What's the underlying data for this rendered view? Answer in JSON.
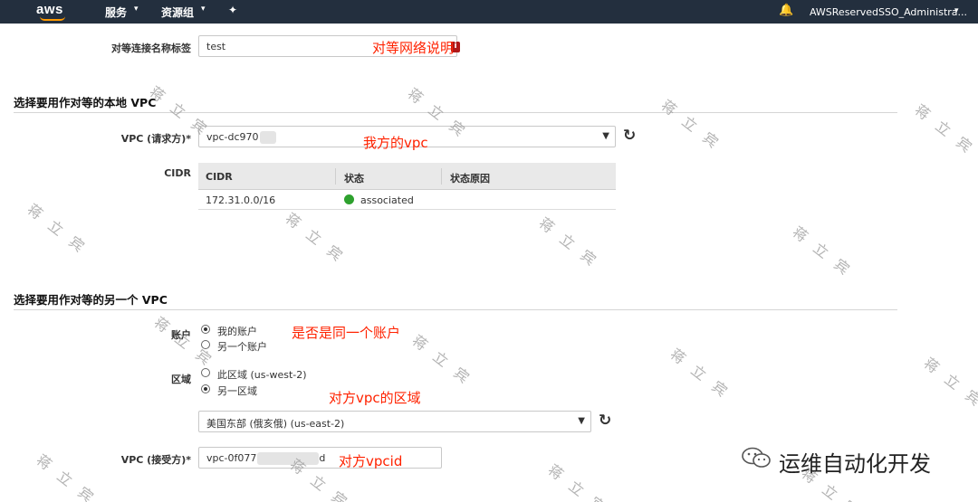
{
  "topnav": {
    "logo": "aws",
    "services": "服务",
    "resource_groups": "资源组",
    "pin": "✦",
    "bell": "🔔",
    "account": "AWSReservedSSO_Administra...",
    "caret": "▾"
  },
  "form": {
    "tag_label": "对等连接名称标签",
    "tag_value": "test",
    "tag_info_icon": "i",
    "local_section_title": "选择要用作对等的本地 VPC",
    "vpc_requester_label": "VPC (请求方)*",
    "vpc_requester_value": "vpc-dc970",
    "cidr_label": "CIDR",
    "cidr_table": {
      "columns": [
        "CIDR",
        "状态",
        "状态原因"
      ],
      "rows": [
        {
          "cidr": "172.31.0.0/16",
          "status": "associated",
          "reason": ""
        }
      ]
    },
    "other_section_title": "选择要用作对等的另一个 VPC",
    "account_label": "账户",
    "account_options": [
      "我的账户",
      "另一个账户"
    ],
    "region_label": "区域",
    "region_options": [
      "此区域 (us-west-2)",
      "另一区域"
    ],
    "region_select_value": "美国东部 (俄亥俄) (us-east-2)",
    "vpc_accepter_label": "VPC (接受方)*",
    "vpc_accepter_value": "vpc-0f077",
    "vpc_accepter_suffix": "d",
    "dropdown": "▼",
    "refresh": "↻"
  },
  "annotations": {
    "tag": "对等网络说明",
    "vpc": "我方的vpc",
    "account": "是否是同一个账户",
    "region": "对方vpc的区域",
    "vpcid": "对方vpcid"
  },
  "watermark": "蒋 立 宾",
  "brand": "运维自动化开发",
  "colors": {
    "nav_bg": "#232f3e",
    "aws_orange": "#ff9900",
    "annotation_red": "#ff2200",
    "status_green": "#2ea12e"
  }
}
